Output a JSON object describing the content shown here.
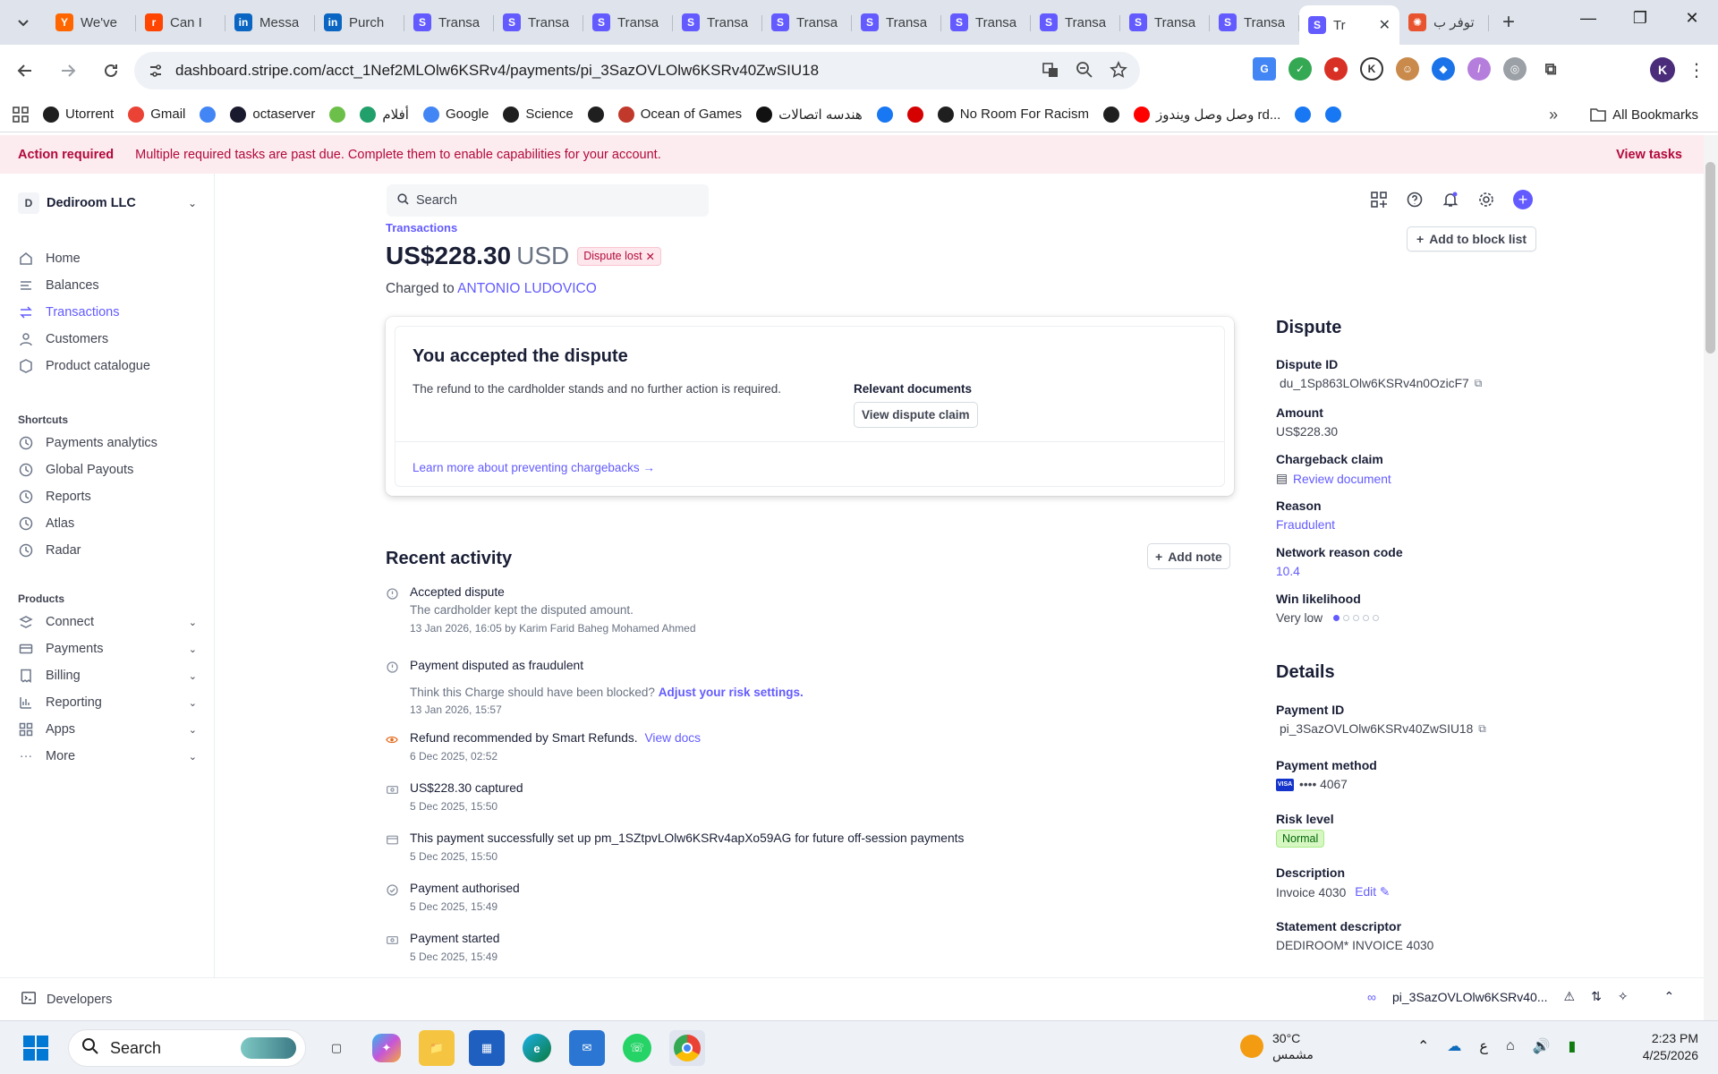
{
  "browser": {
    "tabs": [
      {
        "title": "We've",
        "favicon": "Y",
        "color": "#ff6600"
      },
      {
        "title": "Can I",
        "favicon": "r",
        "color": "#ff4500"
      },
      {
        "title": "Messa",
        "favicon": "in",
        "color": "#0a66c2"
      },
      {
        "title": "Purch",
        "favicon": "in",
        "color": "#0a66c2"
      },
      {
        "title": "Transa",
        "favicon": "S",
        "color": "#635bff"
      },
      {
        "title": "Transa",
        "favicon": "S",
        "color": "#635bff"
      },
      {
        "title": "Transa",
        "favicon": "S",
        "color": "#635bff"
      },
      {
        "title": "Transa",
        "favicon": "S",
        "color": "#635bff"
      },
      {
        "title": "Transa",
        "favicon": "S",
        "color": "#635bff"
      },
      {
        "title": "Transa",
        "favicon": "S",
        "color": "#635bff"
      },
      {
        "title": "Transa",
        "favicon": "S",
        "color": "#635bff"
      },
      {
        "title": "Transa",
        "favicon": "S",
        "color": "#635bff"
      },
      {
        "title": "Transa",
        "favicon": "S",
        "color": "#635bff"
      },
      {
        "title": "Transa",
        "favicon": "S",
        "color": "#635bff"
      },
      {
        "title": "Tr",
        "favicon": "S",
        "color": "#635bff",
        "active": true
      },
      {
        "title": "توفر ب",
        "favicon": "✺",
        "color": "#e8542f"
      }
    ],
    "url": "dashboard.stripe.com/acct_1Nef2MLOlw6KSRv4/payments/pi_3SazOVLOlw6KSRv40ZwSIU18",
    "profile_initial": "K",
    "bookmarks": [
      {
        "label": "Utorrent",
        "icon": "utorrent-icon",
        "color": "#1f1f1f"
      },
      {
        "label": "Gmail",
        "icon": "gmail-icon",
        "color": "#ea4335"
      },
      {
        "label": "",
        "icon": "loading-icon",
        "color": "#4285f4"
      },
      {
        "label": "octaserver",
        "icon": "octaserver-icon",
        "color": "#1a1a2e"
      },
      {
        "label": "",
        "icon": "green-app-icon",
        "color": "#6cc04a"
      },
      {
        "label": "أفلام",
        "icon": "movies-icon",
        "color": "#22a06b"
      },
      {
        "label": "Google",
        "icon": "google-icon",
        "color": "#4285f4"
      },
      {
        "label": "Science",
        "icon": "globe-icon",
        "color": "#1f1f1f"
      },
      {
        "label": "",
        "icon": "globe-icon",
        "color": "#1f1f1f"
      },
      {
        "label": "Ocean of Games",
        "icon": "gamepad-icon",
        "color": "#c0392b"
      },
      {
        "label": "هندسه اتصالات",
        "icon": "me-icon",
        "color": "#111111"
      },
      {
        "label": "",
        "icon": "facebook-icon",
        "color": "#1877f2"
      },
      {
        "label": "",
        "icon": "heart-icon",
        "color": "#d50000"
      },
      {
        "label": "No Room For Racism",
        "icon": "globe-icon",
        "color": "#1f1f1f"
      },
      {
        "label": "",
        "icon": "v-icon",
        "color": "#1f1f1f"
      },
      {
        "label": "وصل وصل ويندوز rd...",
        "icon": "youtube-icon",
        "color": "#ff0000"
      },
      {
        "label": "",
        "icon": "facebook-icon",
        "color": "#1877f2"
      },
      {
        "label": "",
        "icon": "facebook-icon",
        "color": "#1877f2"
      }
    ],
    "all_bookmarks": "All Bookmarks"
  },
  "banner": {
    "title": "Action required",
    "message": "Multiple required tasks are past due. Complete them to enable capabilities for your account.",
    "link": "View tasks"
  },
  "sidebar": {
    "account_initial": "D",
    "account_name": "Dediroom LLC",
    "items": [
      {
        "label": "Home",
        "icon": "home-icon"
      },
      {
        "label": "Balances",
        "icon": "balances-icon"
      },
      {
        "label": "Transactions",
        "icon": "transactions-icon",
        "active": true
      },
      {
        "label": "Customers",
        "icon": "customers-icon"
      },
      {
        "label": "Product catalogue",
        "icon": "product-icon"
      }
    ],
    "shortcuts_title": "Shortcuts",
    "shortcuts": [
      {
        "label": "Payments analytics"
      },
      {
        "label": "Global Payouts"
      },
      {
        "label": "Reports"
      },
      {
        "label": "Atlas"
      },
      {
        "label": "Radar"
      }
    ],
    "products_title": "Products",
    "products": [
      {
        "label": "Connect",
        "icon": "connect-icon"
      },
      {
        "label": "Payments",
        "icon": "payments-icon"
      },
      {
        "label": "Billing",
        "icon": "billing-icon"
      },
      {
        "label": "Reporting",
        "icon": "reporting-icon"
      },
      {
        "label": "Apps",
        "icon": "apps-icon"
      },
      {
        "label": "More",
        "icon": "more-icon"
      }
    ]
  },
  "main": {
    "search_placeholder": "Search",
    "breadcrumb": "Transactions",
    "amount": "US$228.30",
    "currency": "USD",
    "status_badge": "Dispute lost",
    "charged_prefix": "Charged to",
    "customer": "ANTONIO LUDOVICO",
    "block_button": "Add to block list",
    "dispute_card": {
      "title": "You accepted the dispute",
      "description": "The refund to the cardholder stands and no further action is required.",
      "relevant_title": "Relevant documents",
      "view_claim": "View dispute claim",
      "learn_more": "Learn more about preventing chargebacks →"
    },
    "recent_title": "Recent activity",
    "add_note": "Add note",
    "activity": [
      {
        "title": "Accepted dispute",
        "sub": "The cardholder kept the disputed amount.",
        "time": "13 Jan 2026, 16:05 by Karim Farid Baheg Mohamed Ahmed",
        "icon": "info-icon"
      },
      {
        "title": "Payment disputed as fraudulent",
        "sub": "Think this Charge should have been blocked?",
        "sub_link": "Adjust your risk settings.",
        "time": "13 Jan 2026, 15:57",
        "icon": "info-icon"
      },
      {
        "title": "Refund recommended by Smart Refunds.",
        "title_link": "View docs",
        "time": "6 Dec 2025, 02:52",
        "icon": "eye-icon"
      },
      {
        "title": "US$228.30 captured",
        "time": "5 Dec 2025, 15:50",
        "icon": "money-icon"
      },
      {
        "title": "This payment successfully set up pm_1SZtpvLOlw6KSRv4apXo59AG for future off-session payments",
        "time": "5 Dec 2025, 15:50",
        "icon": "card-icon"
      },
      {
        "title": "Payment authorised",
        "time": "5 Dec 2025, 15:49",
        "icon": "check-icon"
      },
      {
        "title": "Payment started",
        "time": "5 Dec 2025, 15:49",
        "icon": "money-icon"
      }
    ],
    "dispute_panel": {
      "title": "Dispute",
      "id_label": "Dispute ID",
      "id_value": "du_1Sp863LOlw6KSRv4n0OzicF7",
      "amount_label": "Amount",
      "amount_value": "US$228.30",
      "claim_label": "Chargeback claim",
      "claim_value": "Review document",
      "reason_label": "Reason",
      "reason_value": "Fraudulent",
      "code_label": "Network reason code",
      "code_value": "10.4",
      "win_label": "Win likelihood",
      "win_value": "Very low",
      "win_level": 1,
      "win_max": 5
    },
    "details_panel": {
      "title": "Details",
      "payment_id_label": "Payment ID",
      "payment_id_value": "pi_3SazOVLOlw6KSRv40ZwSIU18",
      "method_label": "Payment method",
      "card_brand": "VISA",
      "method_value": "•••• 4067",
      "risk_label": "Risk level",
      "risk_value": "Normal",
      "desc_label": "Description",
      "desc_value": "Invoice 4030",
      "edit_label": "Edit",
      "statement_label": "Statement descriptor",
      "statement_value": "DEDIROOM* INVOICE 4030"
    }
  },
  "devbar": {
    "label": "Developers",
    "object_id": "pi_3SazOVLOlw6KSRv40..."
  },
  "taskbar": {
    "search": "Search",
    "temperature": "30°C",
    "weather_text": "مشمس",
    "lang": "ع",
    "time": "2:23 PM",
    "date": "4/25/2026"
  },
  "colors": {
    "accent": "#635bff",
    "danger": "#b3093c",
    "success": "#006908"
  }
}
